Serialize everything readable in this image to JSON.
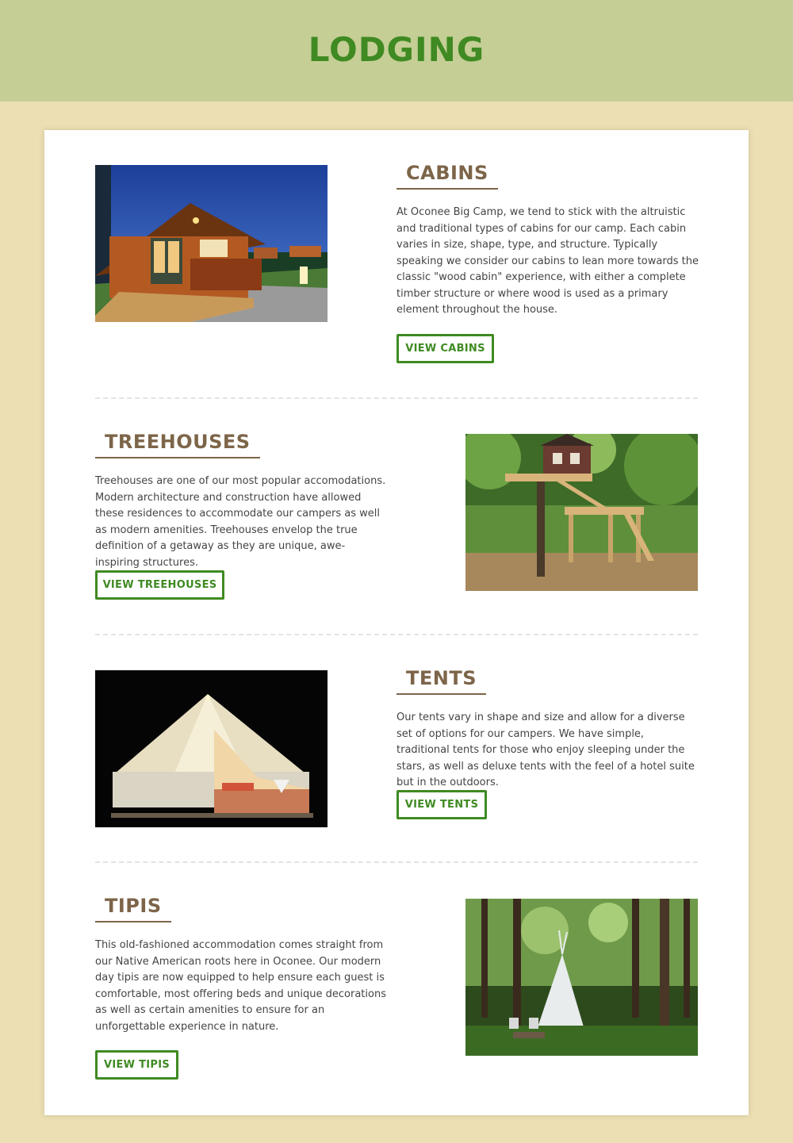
{
  "header": {
    "title": "LODGING"
  },
  "sections": [
    {
      "title": "CABINS",
      "description": "At Oconee Big Camp, we tend to stick with the altruistic and traditional types of cabins for our camp. Each cabin varies in size, shape, type, and structure. Typically speaking we consider our cabins to lean more towards the classic \"wood cabin\" experience, with either a complete timber structure or where wood is used as a primary element throughout the house.",
      "button": "VIEW CABINS"
    },
    {
      "title": "TREEHOUSES",
      "description": "Treehouses are one of our most popular accomodations. Modern architecture and construction have allowed these residences to accommodate our campers as well as modern amenities. Treehouses envelop the true definition of a getaway as they are unique, awe-inspiring structures.",
      "button": "VIEW TREEHOUSES"
    },
    {
      "title": "TENTS",
      "description": "Our tents vary in shape and size and allow for a diverse set of options for our campers. We have simple, traditional tents for those who enjoy sleeping under the stars, as well as deluxe tents with the feel of a hotel suite but in the outdoors.",
      "button": "VIEW TENTS"
    },
    {
      "title": "TIPIS",
      "description": "This old-fashioned accommodation comes straight from our Native American roots here in Oconee. Our modern day tipis are now equipped to help ensure each guest is comfortable, most offering beds and unique decorations as well as certain amenities to ensure for an unforgettable experience in nature.",
      "button": "VIEW TIPIS"
    }
  ]
}
